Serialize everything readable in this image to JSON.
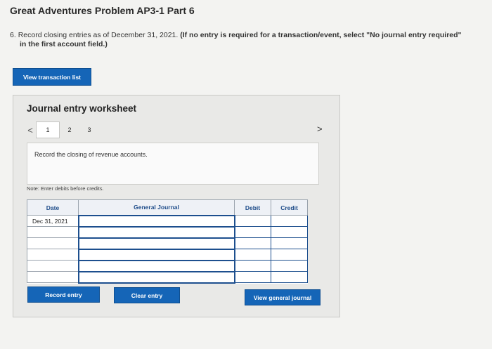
{
  "page": {
    "title": "Great Adventures Problem AP3-1 Part 6",
    "instruction_number": "6.",
    "instruction_text": "Record closing entries as of December 31, 2021.",
    "instruction_bold_1": "(If no entry is required for a transaction/event, select \"No journal entry required\"",
    "instruction_bold_2": "in the first account field.)"
  },
  "buttons": {
    "view_transaction_list": "View transaction list",
    "record_entry": "Record entry",
    "clear_entry": "Clear entry",
    "view_general_journal": "View general journal"
  },
  "worksheet": {
    "title": "Journal entry worksheet",
    "pager": {
      "prev": "<",
      "next": ">",
      "pages": [
        "1",
        "2",
        "3"
      ],
      "active_page": "1"
    },
    "description": "Record the closing of revenue accounts.",
    "note": "Note: Enter debits before credits.",
    "table": {
      "headers": {
        "date": "Date",
        "account": "General Journal",
        "debit": "Debit",
        "credit": "Credit"
      },
      "rows": [
        {
          "date": "Dec 31, 2021",
          "account": "",
          "debit": "",
          "credit": ""
        },
        {
          "date": "",
          "account": "",
          "debit": "",
          "credit": ""
        },
        {
          "date": "",
          "account": "",
          "debit": "",
          "credit": ""
        },
        {
          "date": "",
          "account": "",
          "debit": "",
          "credit": ""
        },
        {
          "date": "",
          "account": "",
          "debit": "",
          "credit": ""
        },
        {
          "date": "",
          "account": "",
          "debit": "",
          "credit": ""
        }
      ]
    }
  },
  "colors": {
    "button_blue": "#1565b7",
    "header_text": "#1f4d8a",
    "input_border": "#1d4f8e"
  }
}
